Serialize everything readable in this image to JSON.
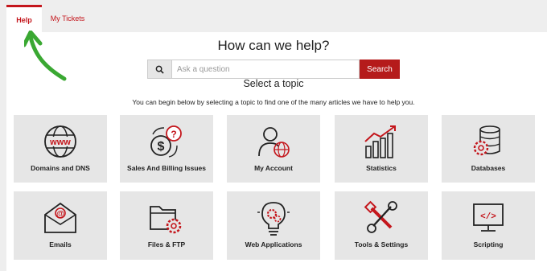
{
  "tabs": [
    {
      "label": "Help",
      "active": true
    },
    {
      "label": "My Tickets",
      "active": false
    }
  ],
  "heading": "How can we help?",
  "search": {
    "placeholder": "Ask a question",
    "value": "",
    "button_label": "Search",
    "icon": "search-icon"
  },
  "topic_heading": "Select a topic",
  "topic_description": "You can begin below by selecting a topic to find one of the many articles we have to help you.",
  "topics": [
    {
      "label": "Domains and DNS",
      "icon": "www-globe-icon"
    },
    {
      "label": "Sales And Billing Issues",
      "icon": "billing-icon"
    },
    {
      "label": "My Account",
      "icon": "account-icon"
    },
    {
      "label": "Statistics",
      "icon": "statistics-icon"
    },
    {
      "label": "Databases",
      "icon": "database-icon"
    },
    {
      "label": "Emails",
      "icon": "email-icon"
    },
    {
      "label": "Files & FTP",
      "icon": "folder-gear-icon"
    },
    {
      "label": "Web Applications",
      "icon": "lightbulb-icon"
    },
    {
      "label": "Tools & Settings",
      "icon": "tools-icon"
    },
    {
      "label": "Scripting",
      "icon": "code-monitor-icon"
    }
  ],
  "colors": {
    "accent": "#c4161c",
    "button": "#b51b1b",
    "tile": "#e6e6e6",
    "arrow": "#3aa832"
  }
}
